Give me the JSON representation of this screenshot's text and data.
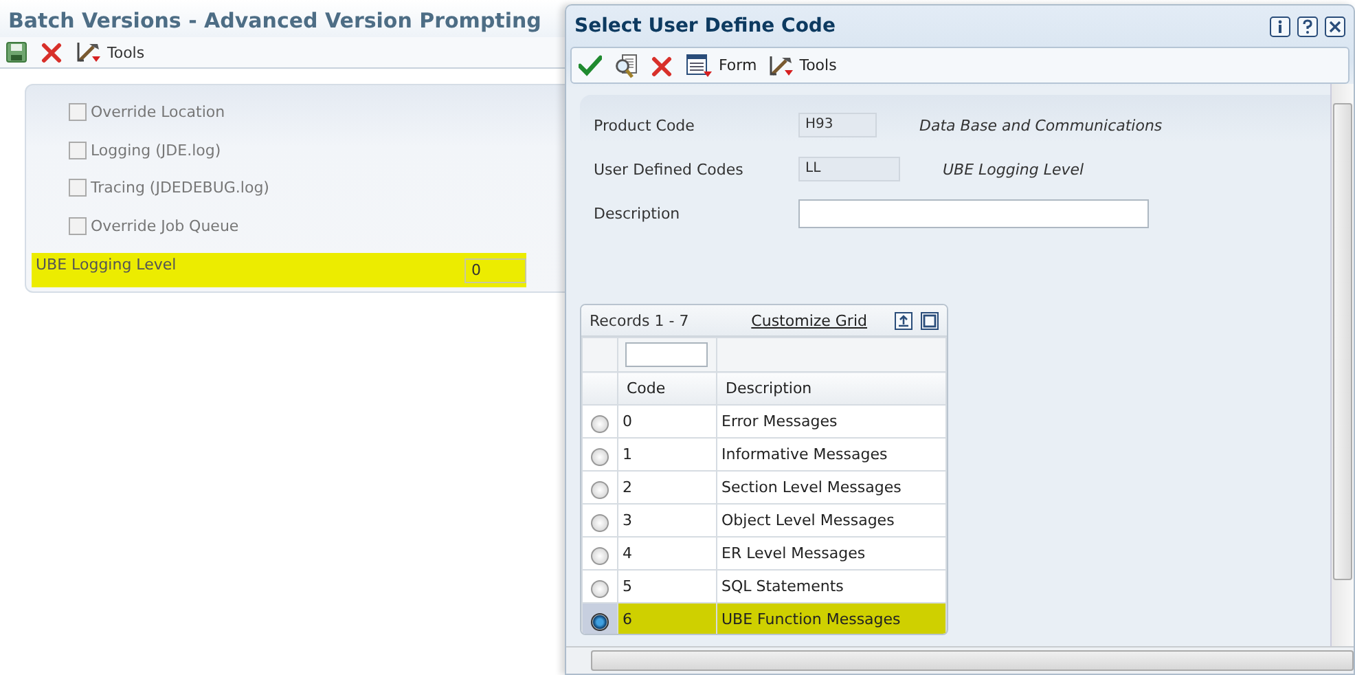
{
  "background_form": {
    "title": "Batch Versions - Advanced Version Prompting",
    "toolbar": [
      {
        "kind": "save"
      },
      {
        "kind": "cancel"
      },
      {
        "kind": "tools",
        "label": "Tools"
      }
    ],
    "options": [
      {
        "label": "Override Location",
        "checked": false
      },
      {
        "label": "Logging (JDE.log)",
        "checked": false
      },
      {
        "label": "Tracing (JDEDEBUG.log)",
        "checked": false
      },
      {
        "label": "Override Job Queue",
        "checked": false
      }
    ],
    "logging_level": {
      "label": "UBE Logging Level",
      "value": "0",
      "highlighted": true
    }
  },
  "dialog": {
    "title": "Select User Define Code",
    "title_buttons": [
      {
        "kind": "info"
      },
      {
        "kind": "help"
      },
      {
        "kind": "close"
      }
    ],
    "toolbar": [
      {
        "kind": "select"
      },
      {
        "kind": "find"
      },
      {
        "kind": "cancel"
      },
      {
        "kind": "form",
        "label": "Form"
      },
      {
        "kind": "tools",
        "label": "Tools"
      }
    ],
    "fields": [
      {
        "kind": "readonly",
        "label": "Product Code",
        "value": "H93",
        "description": "Data Base and Communications"
      },
      {
        "kind": "readonly",
        "label": "User Defined Codes",
        "value": "LL",
        "description": "UBE Logging Level"
      },
      {
        "kind": "input",
        "label": "Description"
      }
    ],
    "grid": {
      "records": "Records 1 - 7",
      "customize": "Customize Grid",
      "columns": [
        "Code",
        "Description"
      ],
      "rows": [
        {
          "code": "0",
          "description": "Error Messages",
          "selected": false,
          "highlighted": false
        },
        {
          "code": "1",
          "description": "Informative Messages",
          "selected": false,
          "highlighted": false
        },
        {
          "code": "2",
          "description": "Section Level Messages",
          "selected": false,
          "highlighted": false
        },
        {
          "code": "3",
          "description": "Object Level Messages",
          "selected": false,
          "highlighted": false
        },
        {
          "code": "4",
          "description": "ER Level Messages",
          "selected": false,
          "highlighted": false
        },
        {
          "code": "5",
          "description": "SQL Statements",
          "selected": false,
          "highlighted": false
        },
        {
          "code": "6",
          "description": "UBE Function Messages",
          "selected": true,
          "highlighted": true
        }
      ]
    }
  }
}
